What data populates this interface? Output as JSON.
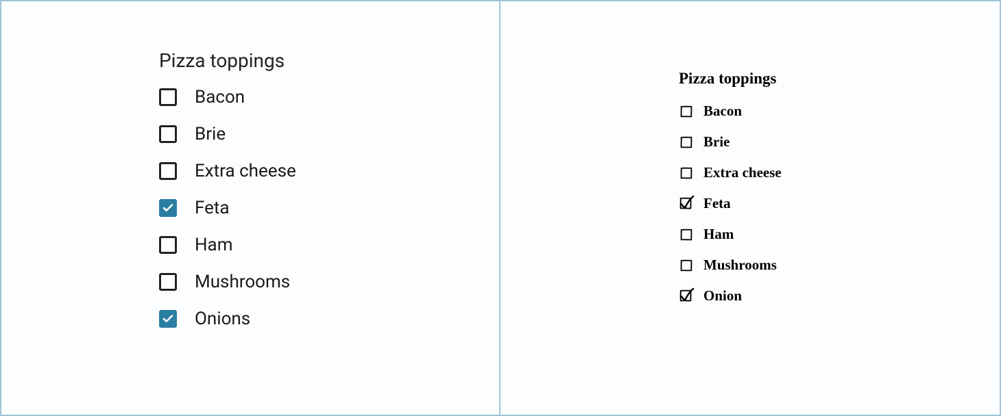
{
  "left": {
    "title": "Pizza toppings",
    "items": [
      {
        "label": "Bacon",
        "checked": false
      },
      {
        "label": "Brie",
        "checked": false
      },
      {
        "label": "Extra cheese",
        "checked": false
      },
      {
        "label": "Feta",
        "checked": true
      },
      {
        "label": "Ham",
        "checked": false
      },
      {
        "label": "Mushrooms",
        "checked": false
      },
      {
        "label": "Onions",
        "checked": true
      }
    ],
    "accent_color": "#2b7ea1"
  },
  "right": {
    "title": "Pizza toppings",
    "items": [
      {
        "label": "Bacon",
        "checked": false
      },
      {
        "label": "Brie",
        "checked": false
      },
      {
        "label": "Extra cheese",
        "checked": false
      },
      {
        "label": "Feta",
        "checked": true
      },
      {
        "label": "Ham",
        "checked": false
      },
      {
        "label": "Mushrooms",
        "checked": false
      },
      {
        "label": "Onion",
        "checked": true
      }
    ]
  }
}
